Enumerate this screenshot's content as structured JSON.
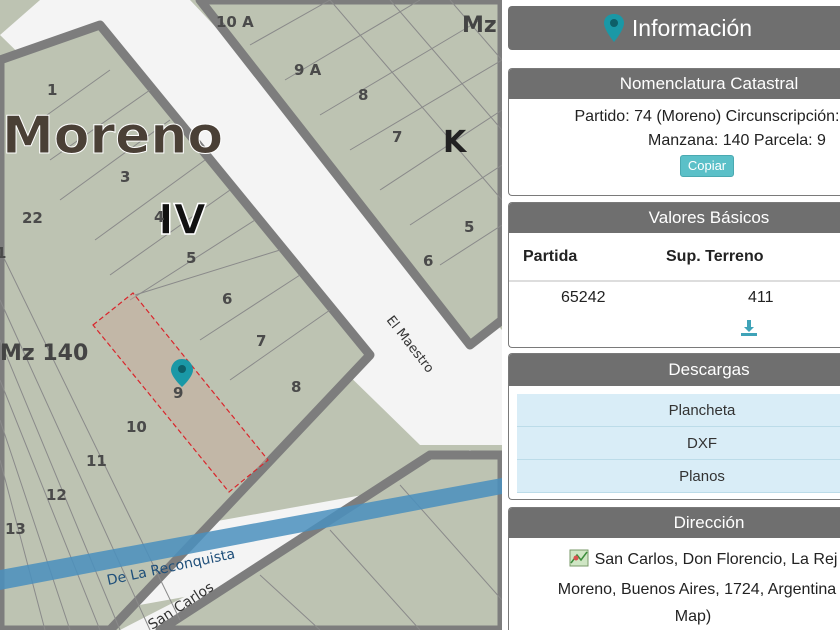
{
  "map": {
    "city_label": "Moreno",
    "zone_label": "IV",
    "block_label_main": "Mz 140",
    "block_label_corner": "Mz",
    "block_letter": "K",
    "parcel_numbers": [
      "10 A",
      "9 A",
      "8",
      "7",
      "1",
      "3",
      "22",
      "4",
      "5",
      "6",
      "7",
      "8",
      "9",
      "10",
      "11",
      "12",
      "13",
      "1",
      "5",
      "6"
    ],
    "streets": [
      "El Maestro",
      "De La Reconquista",
      "San Carlos"
    ],
    "colors": {
      "parcel_fill": "#bdc3b2",
      "block_border": "#7d7d7d",
      "road": "#f4f4f4",
      "river": "#4a8fbd",
      "highlight": "#c8a89a",
      "marker": "#1a98a6"
    }
  },
  "panel": {
    "title": "Información",
    "nomenclatura": {
      "header": "Nomenclatura Catastral",
      "line1": "Partido: 74 (Moreno) Circunscripción:",
      "line2": "Manzana: 140 Parcela: 9",
      "copy_label": "Copiar"
    },
    "valores": {
      "header": "Valores Básicos",
      "col_partida": "Partida",
      "col_sup": "Sup. Terreno",
      "partida": "65242",
      "sup": "411"
    },
    "descargas": {
      "header": "Descargas",
      "items": [
        "Plancheta",
        "DXF",
        "Planos"
      ]
    },
    "direccion": {
      "header": "Dirección",
      "line1": "San Carlos, Don Florencio, La Rej",
      "line2": "Moreno, Buenos Aires, 1724, Argentina",
      "line3": "Map)"
    }
  }
}
